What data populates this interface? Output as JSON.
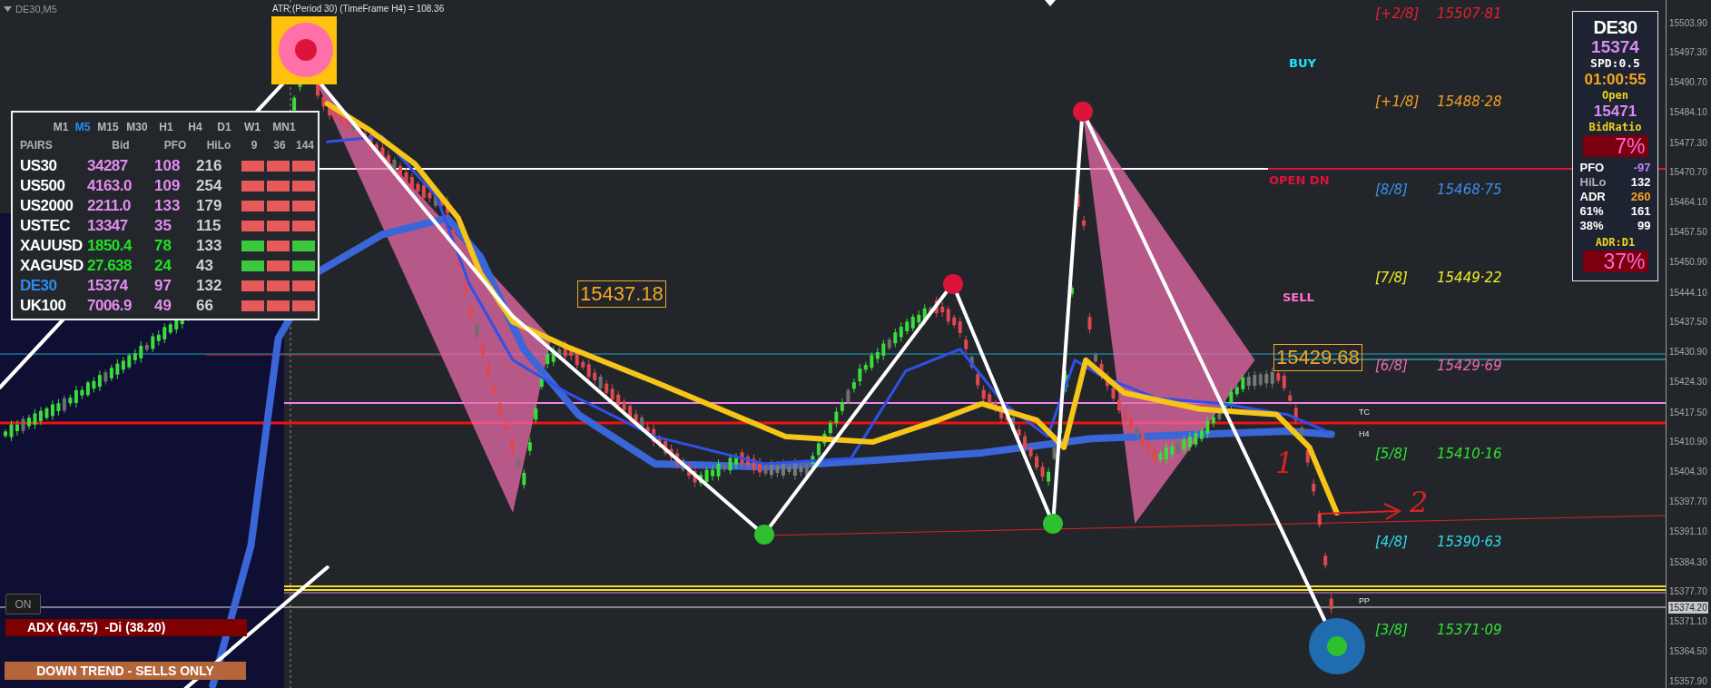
{
  "chart": {
    "symbol": "DE30,M5",
    "indicator_label": "ATR (Period 30) (TimeFrame H4) = 108.36",
    "price_axis": [
      {
        "label": "15503.90",
        "current": false
      },
      {
        "label": "15497.30",
        "current": false
      },
      {
        "label": "15490.70",
        "current": false
      },
      {
        "label": "15484.10",
        "current": false
      },
      {
        "label": "15477.30",
        "current": false
      },
      {
        "label": "15470.70",
        "current": false
      },
      {
        "label": "15464.10",
        "current": false
      },
      {
        "label": "15457.50",
        "current": false
      },
      {
        "label": "15450.90",
        "current": false
      },
      {
        "label": "15444.10",
        "current": false
      },
      {
        "label": "15437.50",
        "current": false
      },
      {
        "label": "15430.90",
        "current": false
      },
      {
        "label": "15424.30",
        "current": false
      },
      {
        "label": "15417.50",
        "current": false
      },
      {
        "label": "15410.90",
        "current": false
      },
      {
        "label": "15404.30",
        "current": false
      },
      {
        "label": "15397.70",
        "current": false
      },
      {
        "label": "15391.10",
        "current": false
      },
      {
        "label": "15384.30",
        "current": false
      },
      {
        "label": "15377.70",
        "current": false
      },
      {
        "label": "15374.20",
        "current": true
      },
      {
        "label": "15371.10",
        "current": false
      },
      {
        "label": "15364.50",
        "current": false
      },
      {
        "label": "15357.90",
        "current": false
      }
    ],
    "murrey_levels": [
      {
        "label": "[+2/8]",
        "value": "15507·81",
        "color": "#e8202a"
      },
      {
        "label": "[+1/8]",
        "value": "15488·28",
        "color": "#f5a020"
      },
      {
        "label": "[8/8]",
        "value": "15468·75",
        "color": "#3a8ef0"
      },
      {
        "label": "[7/8]",
        "value": "15449·22",
        "color": "#f0f020"
      },
      {
        "label": "[6/8]",
        "value": "15429·69",
        "color": "#f06ab0"
      },
      {
        "label": "[5/8]",
        "value": "15410·16",
        "color": "#30e030"
      },
      {
        "label": "[4/8]",
        "value": "15390·63",
        "color": "#30d8e8"
      },
      {
        "label": "[3/8]",
        "value": "15371·09",
        "color": "#30e030"
      }
    ],
    "signals": [
      {
        "label": "BUY",
        "color": "#22e4f4"
      },
      {
        "label": "OPEN DN",
        "color": "#dc143c"
      },
      {
        "label": "SELL",
        "color": "#ff70c8"
      }
    ],
    "price_boxes": [
      "15437.18",
      "15429.68"
    ],
    "line_tags": [
      "TC",
      "H4",
      "PP"
    ],
    "annotations": [
      "1",
      "2"
    ]
  },
  "pairs_panel": {
    "timeframes": [
      {
        "label": "M1",
        "selected": false
      },
      {
        "label": "M5",
        "selected": true
      },
      {
        "label": "M15",
        "selected": false
      },
      {
        "label": "M30",
        "selected": false
      },
      {
        "label": "H1",
        "selected": false
      },
      {
        "label": "H4",
        "selected": false
      },
      {
        "label": "D1",
        "selected": false
      },
      {
        "label": "W1",
        "selected": false
      },
      {
        "label": "MN1",
        "selected": false
      }
    ],
    "columns": [
      "PAIRS",
      "Bid",
      "PFO",
      "HiLo",
      "9",
      "36",
      "144"
    ],
    "rows": [
      {
        "pair": "US30",
        "selected": false,
        "bid": "34287",
        "pfo": "108",
        "hilo": "216",
        "rising": false,
        "signals": [
          {
            "up": false
          },
          {
            "up": false
          },
          {
            "up": false
          }
        ]
      },
      {
        "pair": "US500",
        "selected": false,
        "bid": "4163.0",
        "pfo": "109",
        "hilo": "254",
        "rising": false,
        "signals": [
          {
            "up": false
          },
          {
            "up": false
          },
          {
            "up": false
          }
        ]
      },
      {
        "pair": "US2000",
        "selected": false,
        "bid": "2211.0",
        "pfo": "133",
        "hilo": "179",
        "rising": false,
        "signals": [
          {
            "up": false
          },
          {
            "up": false
          },
          {
            "up": false
          }
        ]
      },
      {
        "pair": "USTEC",
        "selected": false,
        "bid": "13347",
        "pfo": "35",
        "hilo": "115",
        "rising": false,
        "signals": [
          {
            "up": false
          },
          {
            "up": false
          },
          {
            "up": false
          }
        ]
      },
      {
        "pair": "XAUUSD",
        "selected": false,
        "bid": "1850.4",
        "pfo": "78",
        "hilo": "133",
        "rising": true,
        "signals": [
          {
            "up": true
          },
          {
            "up": false
          },
          {
            "up": true
          }
        ]
      },
      {
        "pair": "XAGUSD",
        "selected": false,
        "bid": "27.638",
        "pfo": "24",
        "hilo": "43",
        "rising": true,
        "signals": [
          {
            "up": true
          },
          {
            "up": false
          },
          {
            "up": true
          }
        ]
      },
      {
        "pair": "DE30",
        "selected": true,
        "bid": "15374",
        "pfo": "97",
        "hilo": "132",
        "rising": false,
        "signals": [
          {
            "up": false
          },
          {
            "up": false
          },
          {
            "up": false
          }
        ]
      },
      {
        "pair": "UK100",
        "selected": false,
        "bid": "7006.9",
        "pfo": "49",
        "hilo": "66",
        "rising": false,
        "signals": [
          {
            "up": false
          },
          {
            "up": false
          },
          {
            "up": false
          }
        ]
      }
    ]
  },
  "info_panel": {
    "symbol": "DE30",
    "price": "15374",
    "spread": "SPD:0.5",
    "timer": "01:00:55",
    "open_label": "Open",
    "open_price": "15471",
    "ratio_label": "BidRatio",
    "ratio_value": "7%",
    "stats": [
      {
        "kind": "pfo",
        "label": "PFO",
        "value": "-97"
      },
      {
        "kind": "hilo",
        "label": "HiLo",
        "value": "132"
      },
      {
        "kind": "adr",
        "label": "ADR",
        "value": "260"
      },
      {
        "kind": "level",
        "label": "61%",
        "value": "161"
      },
      {
        "kind": "level",
        "label": "38%",
        "value": "99"
      }
    ],
    "adr_label": "ADR:D1",
    "adr_value": "37%"
  },
  "adx_panel": {
    "toggle": "ON",
    "reading": "ADX (46.75)  -Di (38.20)",
    "trend": "DOWN TREND - SELLS ONLY"
  }
}
